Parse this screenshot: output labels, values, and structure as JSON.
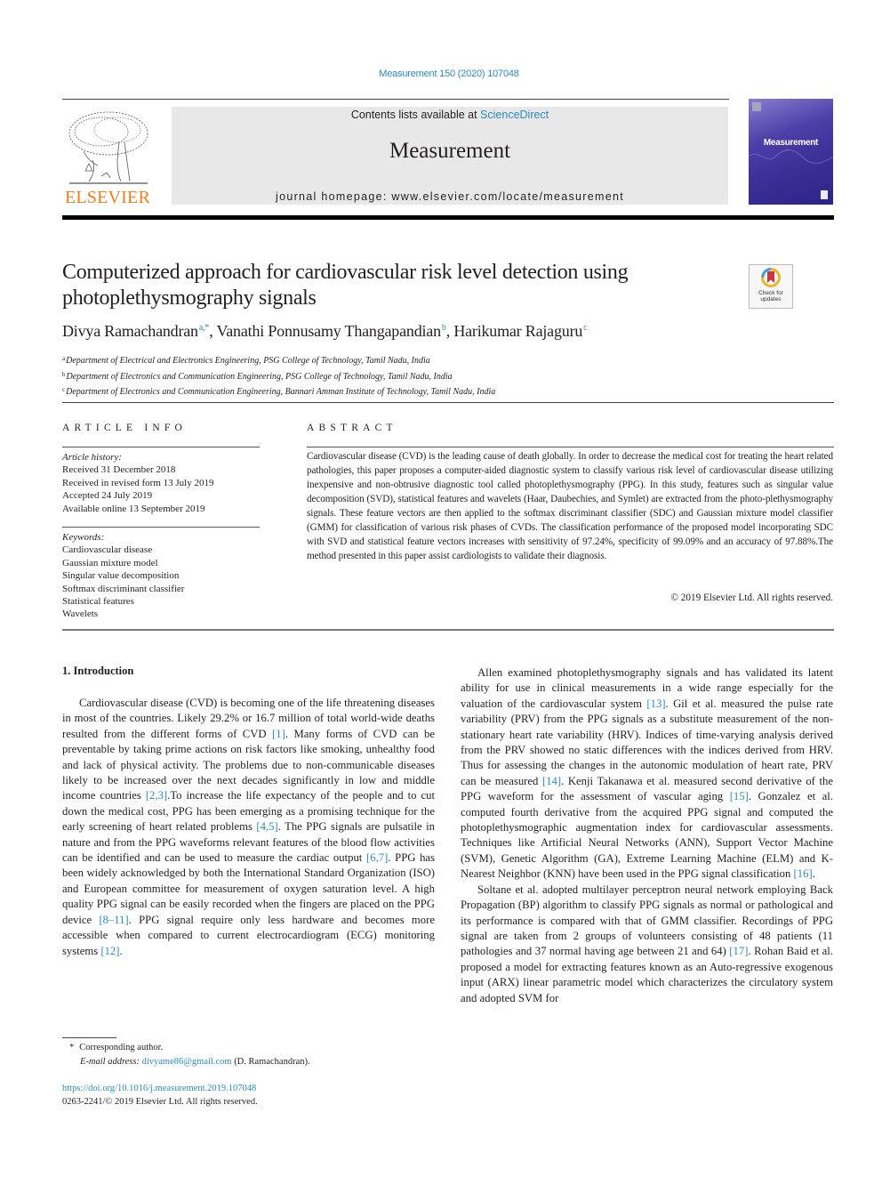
{
  "journal_ref": "Measurement 150 (2020) 107048",
  "header": {
    "publisher_logo_text": "ELSEVIER",
    "contents_prefix": "Contents lists available at ",
    "contents_link": "ScienceDirect",
    "journal_title": "Measurement",
    "homepage": "journal homepage: www.elsevier.com/locate/measurement",
    "cover_title": "Measurement"
  },
  "crossmark": {
    "label": "Check for updates"
  },
  "article": {
    "title": "Computerized approach for cardiovascular risk level detection using photoplethysmography signals",
    "authors": [
      {
        "name": "Divya Ramachandran",
        "sup": "a,*"
      },
      {
        "name": "Vanathi Ponnusamy Thangapandian",
        "sup": "b"
      },
      {
        "name": "Harikumar Rajaguru",
        "sup": "c"
      }
    ],
    "affiliations": [
      {
        "key": "a",
        "text": "Department of Electrical and Electronics Engineering, PSG College of Technology, Tamil Nadu, India"
      },
      {
        "key": "b",
        "text": "Department of Electronics and Communication Engineering, PSG College of Technology, Tamil Nadu, India"
      },
      {
        "key": "c",
        "text": "Department of Electronics and Communication Engineering, Bannari Amman Institute of Technology, Tamil Nadu, India"
      }
    ]
  },
  "article_info": {
    "heading": "ARTICLE INFO",
    "history_label": "Article history:",
    "history": [
      "Received 31 December 2018",
      "Received in revised form 13 July 2019",
      "Accepted 24 July 2019",
      "Available online 13 September 2019"
    ],
    "keywords_label": "Keywords:",
    "keywords": [
      "Cardiovascular disease",
      "Gaussian mixture model",
      "Singular value decomposition",
      "Softmax discriminant classifier",
      "Statistical features",
      "Wavelets"
    ]
  },
  "abstract": {
    "heading": "ABSTRACT",
    "text": "Cardiovascular disease (CVD) is the leading cause of death globally. In order to decrease the medical cost for treating the heart related pathologies, this paper proposes a computer-aided diagnostic system to classify various risk level of cardiovascular disease utilizing inexpensive and non-obtrusive diagnostic tool called photoplethysmography (PPG). In this study, features such as singular value decomposition (SVD), statistical features and wavelets (Haar, Daubechies, and Symlet) are extracted from the photo-plethysmography signals. These feature vectors are then applied to the softmax discriminant classifier (SDC) and Gaussian mixture model classifier (GMM) for classification of various risk phases of CVDs. The classification performance of the proposed model incorporating SDC with SVD and statistical feature vectors increases with sensitivity of 97.24%, specificity of 99.09% and an accuracy of 97.88%.The method presented in this paper assist cardiologists to validate their diagnosis.",
    "copyright": "© 2019 Elsevier Ltd. All rights reserved."
  },
  "body": {
    "section_heading": "1. Introduction",
    "left_paragraphs": [
      [
        {
          "t": "Cardiovascular disease (CVD) is becoming one of the life threatening diseases in most of the countries. Likely 29.2% or 16.7 million of total world-wide deaths resulted from the different forms of CVD "
        },
        {
          "c": "[1]"
        },
        {
          "t": ". Many forms of CVD can be preventable by taking prime actions on risk factors like smoking, unhealthy food and lack of physical activity. The problems due to non-communicable diseases likely to be increased over the next decades significantly in low and middle income countries "
        },
        {
          "c": "[2,3]"
        },
        {
          "t": ".To increase the life expectancy of the people and to cut down the medical cost, PPG has been emerging as a promising technique for the early screening of heart related problems "
        },
        {
          "c": "[4,5]"
        },
        {
          "t": ". The PPG signals are pulsatile in nature and from the PPG waveforms relevant features of the blood flow activities can be identified and can be used to measure the cardiac output "
        },
        {
          "c": "[6,7]"
        },
        {
          "t": ". PPG has been widely acknowledged by both the International Standard Organization (ISO) and European committee for measurement of oxygen saturation level. A high quality PPG signal can be easily recorded when the fingers are placed on the PPG device "
        },
        {
          "c": "[8–11]"
        },
        {
          "t": ". PPG signal require only less hardware and becomes more accessible when compared to current electrocardiogram (ECG) monitoring systems "
        },
        {
          "c": "[12]"
        },
        {
          "t": "."
        }
      ]
    ],
    "right_paragraphs": [
      [
        {
          "t": "Allen examined photoplethysmography signals and has validated its latent ability for use in clinical measurements in a wide range especially for the valuation of the cardiovascular system "
        },
        {
          "c": "[13]"
        },
        {
          "t": ". Gil et al. measured the pulse rate variability (PRV) from the PPG signals as a substitute measurement of the non-stationary heart rate variability (HRV). Indices of time-varying analysis derived from the PRV showed no static differences with the indices derived from HRV. Thus for assessing the changes in the autonomic modulation of heart rate, PRV can be measured "
        },
        {
          "c": "[14]"
        },
        {
          "t": ". Kenji Takanawa et al. measured second derivative of the PPG waveform for the assessment of vascular aging "
        },
        {
          "c": "[15]"
        },
        {
          "t": ". Gonzalez et al. computed fourth derivative from the acquired PPG signal and computed the photoplethysmographic augmentation index for cardiovascular assessments. Techniques like Artificial Neural Networks (ANN), Support Vector Machine (SVM), Genetic Algorithm (GA), Extreme Learning Machine (ELM) and K-Nearest Neighbor (KNN) have been used in the PPG signal classification "
        },
        {
          "c": "[16]"
        },
        {
          "t": "."
        }
      ],
      [
        {
          "t": "Soltane et al. adopted multilayer perceptron neural network employing Back Propagation (BP) algorithm to classify PPG signals as normal or pathological and its performance is compared with that of GMM classifier. Recordings of PPG signal are taken from 2 groups of volunteers consisting of 48 patients (11 pathologies and 37 normal having age between 21 and 64) "
        },
        {
          "c": "[17]"
        },
        {
          "t": ". Rohan Baid et al. proposed a model for extracting features known as an Auto-regressive exogenous input (ARX) linear parametric model which characterizes the circulatory system and adopted SVM for"
        }
      ]
    ]
  },
  "footnote": {
    "marker": "*",
    "corresponding": "Corresponding author.",
    "email_label": "E-mail address: ",
    "email": "divyame86@gmail.com",
    "email_suffix": " (D. Ramachandran)."
  },
  "doi": {
    "link": "https://doi.org/10.1016/j.measurement.2019.107048",
    "issn_line": "0263-2241/© 2019 Elsevier Ltd. All rights reserved."
  },
  "colors": {
    "link": "#2a8cc4",
    "elsevier_orange": "#f07f1b",
    "header_box": "#e8e8e8"
  }
}
